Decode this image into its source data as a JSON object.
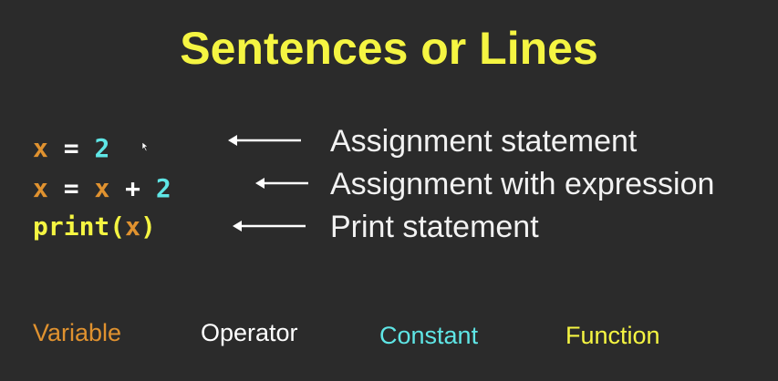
{
  "title": "Sentences or Lines",
  "code": {
    "line1": {
      "var": "x",
      "op": " = ",
      "const": "2"
    },
    "line2": {
      "var1": "x",
      "op1": " = ",
      "var2": "x",
      "op2": " + ",
      "const": "2"
    },
    "line3": {
      "func": "print(",
      "var": "x",
      "func_close": ")"
    }
  },
  "descriptions": {
    "line1": "Assignment statement",
    "line2": "Assignment with expression",
    "line3": "Print statement"
  },
  "legend": {
    "variable": "Variable",
    "operator": "Operator",
    "constant": "Constant",
    "function": "Function"
  },
  "colors": {
    "background": "#2b2b2b",
    "variable": "#e0922f",
    "operator": "#ffffff",
    "constant": "#5fe6e6",
    "function": "#f5f542",
    "title": "#f5f542"
  }
}
